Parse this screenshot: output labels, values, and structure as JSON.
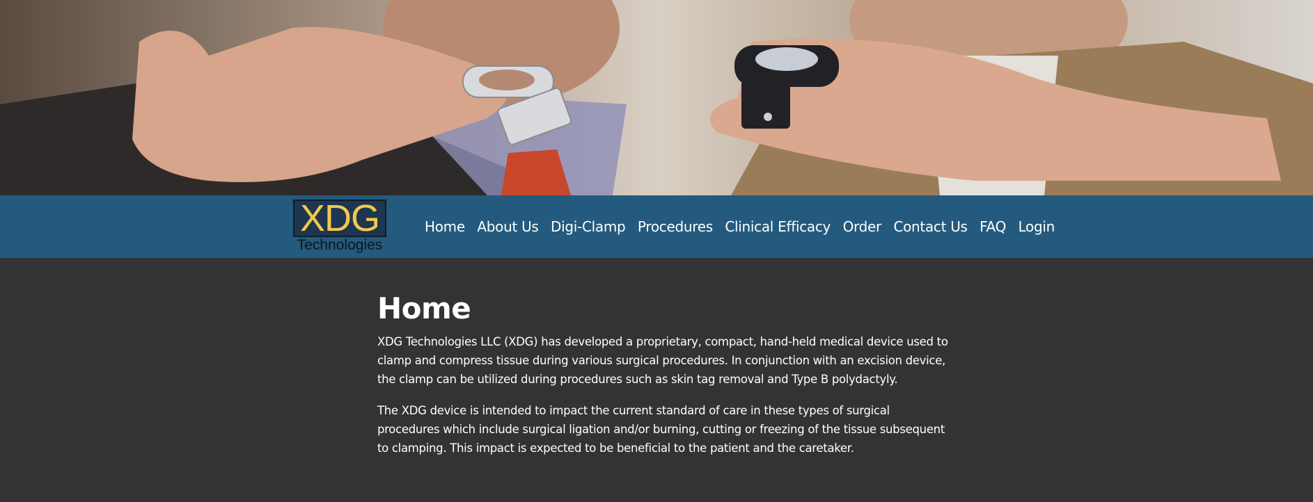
{
  "hero": {
    "image_description": "two hands holding medical clamp devices"
  },
  "navbar": {
    "logo": {
      "mark": "XDG",
      "subtitle": "Technologies"
    },
    "items": [
      {
        "label": "Home"
      },
      {
        "label": "About Us"
      },
      {
        "label": "Digi-Clamp"
      },
      {
        "label": "Procedures"
      },
      {
        "label": "Clinical Efficacy"
      },
      {
        "label": "Order"
      },
      {
        "label": "Contact Us"
      },
      {
        "label": "FAQ"
      },
      {
        "label": "Login"
      }
    ]
  },
  "main": {
    "title": "Home",
    "paragraphs": [
      "XDG Technologies LLC (XDG) has developed a proprietary, compact, hand-held medical device used to clamp and compress tissue during various surgical procedures. In conjunction with an excision device, the clamp can be utilized during procedures such as skin tag removal and Type B polydactyly.",
      "The XDG device is intended to impact the current standard of care in these types of surgical procedures which include surgical ligation and/or burning, cutting or freezing of the tissue subsequent to clamping. This impact is expected to be beneficial to the patient and the caretaker."
    ]
  },
  "colors": {
    "navbar_bg": "#245a7d",
    "page_bg": "#333333",
    "logo_accent": "#f2c94c",
    "text": "#ffffff"
  }
}
